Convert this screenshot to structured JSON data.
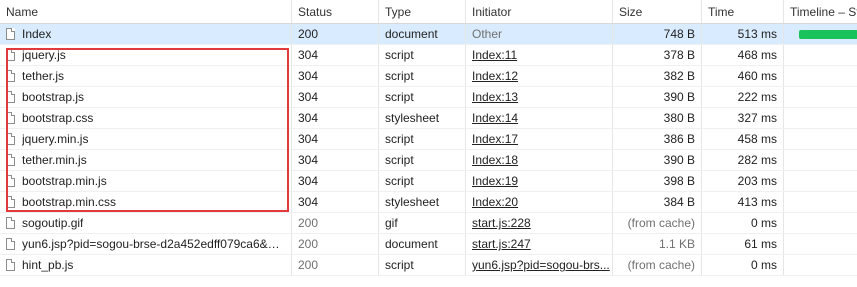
{
  "columns": {
    "name": "Name",
    "status": "Status",
    "type": "Type",
    "initiator": "Initiator",
    "size": "Size",
    "time": "Time",
    "timeline": "Timeline – Sta"
  },
  "rows": [
    {
      "name": "Index",
      "status": "200",
      "type": "document",
      "initiator": "Other",
      "initiator_link": false,
      "size": "748 B",
      "time": "513 ms",
      "selected": true,
      "timeline": true
    },
    {
      "name": "jquery.js",
      "status": "304",
      "type": "script",
      "initiator": "Index:11",
      "initiator_link": true,
      "size": "378 B",
      "time": "468 ms"
    },
    {
      "name": "tether.js",
      "status": "304",
      "type": "script",
      "initiator": "Index:12",
      "initiator_link": true,
      "size": "382 B",
      "time": "460 ms"
    },
    {
      "name": "bootstrap.js",
      "status": "304",
      "type": "script",
      "initiator": "Index:13",
      "initiator_link": true,
      "size": "390 B",
      "time": "222 ms"
    },
    {
      "name": "bootstrap.css",
      "status": "304",
      "type": "stylesheet",
      "initiator": "Index:14",
      "initiator_link": true,
      "size": "380 B",
      "time": "327 ms"
    },
    {
      "name": "jquery.min.js",
      "status": "304",
      "type": "script",
      "initiator": "Index:17",
      "initiator_link": true,
      "size": "386 B",
      "time": "458 ms"
    },
    {
      "name": "tether.min.js",
      "status": "304",
      "type": "script",
      "initiator": "Index:18",
      "initiator_link": true,
      "size": "390 B",
      "time": "282 ms"
    },
    {
      "name": "bootstrap.min.js",
      "status": "304",
      "type": "script",
      "initiator": "Index:19",
      "initiator_link": true,
      "size": "398 B",
      "time": "203 ms"
    },
    {
      "name": "bootstrap.min.css",
      "status": "304",
      "type": "stylesheet",
      "initiator": "Index:20",
      "initiator_link": true,
      "size": "384 B",
      "time": "413 ms"
    },
    {
      "name": "sogoutip.gif",
      "status": "200",
      "type": "gif",
      "initiator": "start.js:228",
      "initiator_link": true,
      "size": "(from cache)",
      "time": "0 ms",
      "muted": true
    },
    {
      "name": "yun6.jsp?pid=sogou-brse-d2a452edff079ca6&w...",
      "status": "200",
      "type": "document",
      "initiator": "start.js:247",
      "initiator_link": true,
      "size": "1.1 KB",
      "time": "61 ms",
      "muted": true
    },
    {
      "name": "hint_pb.js",
      "status": "200",
      "type": "script",
      "initiator": "yun6.jsp?pid=sogou-brs...",
      "initiator_link": true,
      "size": "(from cache)",
      "time": "0 ms",
      "muted": true
    }
  ],
  "colors": {
    "selected_row": "#d9ecff",
    "timeline_bar": "#19c25a",
    "highlight_box": "#e23a3a"
  }
}
